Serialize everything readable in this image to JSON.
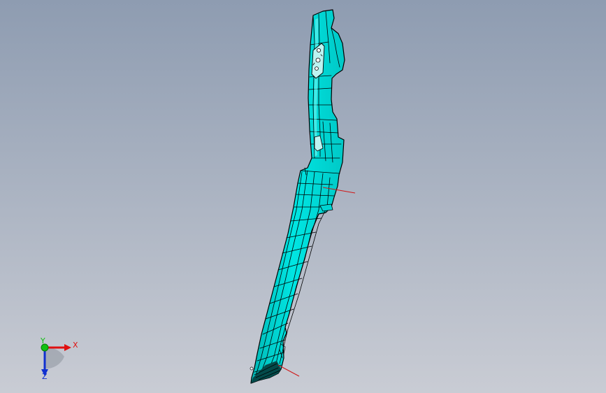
{
  "viewport": {
    "background_top": "#8e9cb1",
    "background_bottom": "#c9ccd4"
  },
  "part": {
    "fill_color": "#00e2e0",
    "edge_color": "#000000",
    "highlight_color": "#7af7f4"
  },
  "triad": {
    "x_label": "X",
    "y_label": "Y",
    "z_label": "Z",
    "x_color": "#e01010",
    "y_color": "#10c010",
    "z_color": "#1030d0"
  },
  "reference_line_color": "#d01818"
}
